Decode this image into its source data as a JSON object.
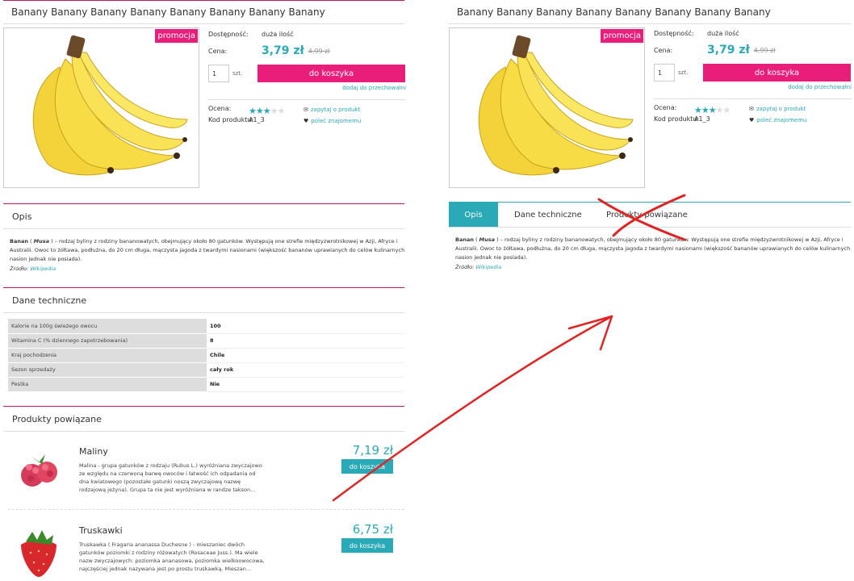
{
  "product": {
    "title": "Banany Banany Banany Banany Banany Banany Banany Banany",
    "promo_badge": "promocja",
    "availability_label": "Dostępność:",
    "availability_value": "duża ilość",
    "price_label": "Cena:",
    "price": "3,79 zł",
    "old_price": "4,99 zł",
    "quantity": "1",
    "unit": "szt.",
    "cart_button": "do koszyka",
    "storage_link": "dodaj do przechowalni",
    "rating_label": "Ocena:",
    "rating": 3,
    "rating_max": 5,
    "ask_link": "zapytaj o produkt",
    "code_label": "Kod produktu:",
    "code_value": "A1_3",
    "recommend_link": "poleć znajomemu"
  },
  "sections": {
    "description_title": "Opis",
    "tech_title": "Dane techniczne",
    "related_title": "Produkty powiązane"
  },
  "description": {
    "name": "Banan",
    "latin": "Musa",
    "text": "– rodzaj byliny z rodziny bananowatych, obejmujący około 80 gatunków. Występują one strefie międzyzwrotnikowej w Azji, Afryce i Australii. Owoc to żółtawa, podłużna, do 20 cm długa, mączysta jagoda z twardymi nasionami (większość bananów uprawianych do celów kulinarnych nasion jednak nie posiada).",
    "source_label": "Źródło:",
    "source_link": "Wikipedia"
  },
  "tech": {
    "rows": [
      {
        "key": "Kalorie na 100g świeżego owocu",
        "value": "100"
      },
      {
        "key": "Witamina C (% dziennego zapotrzebowania)",
        "value": "8"
      },
      {
        "key": "Kraj pochodzenia",
        "value": "Chile"
      },
      {
        "key": "Sezon sprzedaży",
        "value": "cały rok"
      },
      {
        "key": "Pestka",
        "value": "Nie"
      }
    ]
  },
  "related": [
    {
      "name": "Maliny",
      "description": "Malina - grupa gatunków z rodzaju (Rubus L.) wyróżniana zwyczajowo ze względu na czerwoną barwę owoców i łatwość ich odpadania od dna kwiatowego (pozostałe gatunki noszą zwyczajową nazwę rodzajową jeżyna). Grupa ta nie jest wyróżniana w randze takson...",
      "price": "7,19 zł",
      "cart_button": "do koszyka"
    },
    {
      "name": "Truskawki",
      "description": "Truskawka ( Fragaria ananassa Duchesne ) - mieszaniec dwóch gatunków poziomki z rodziny różowatych (Rosaceae Juss.). Ma wiele nazw zwyczajowych: poziomka ananasowa, poziomka wielkoowocowa, najczęściej jednak nazywana jest po prostu truskawką. Mieszan...",
      "price": "6,75 zł",
      "cart_button": "do koszyka"
    }
  ],
  "tabs": [
    "Opis",
    "Dane techniczne",
    "Produkty powiązane"
  ],
  "colors": {
    "accent_teal": "#2aa9b6",
    "accent_pink": "#e91e7a",
    "annotation_red": "#e02424"
  }
}
